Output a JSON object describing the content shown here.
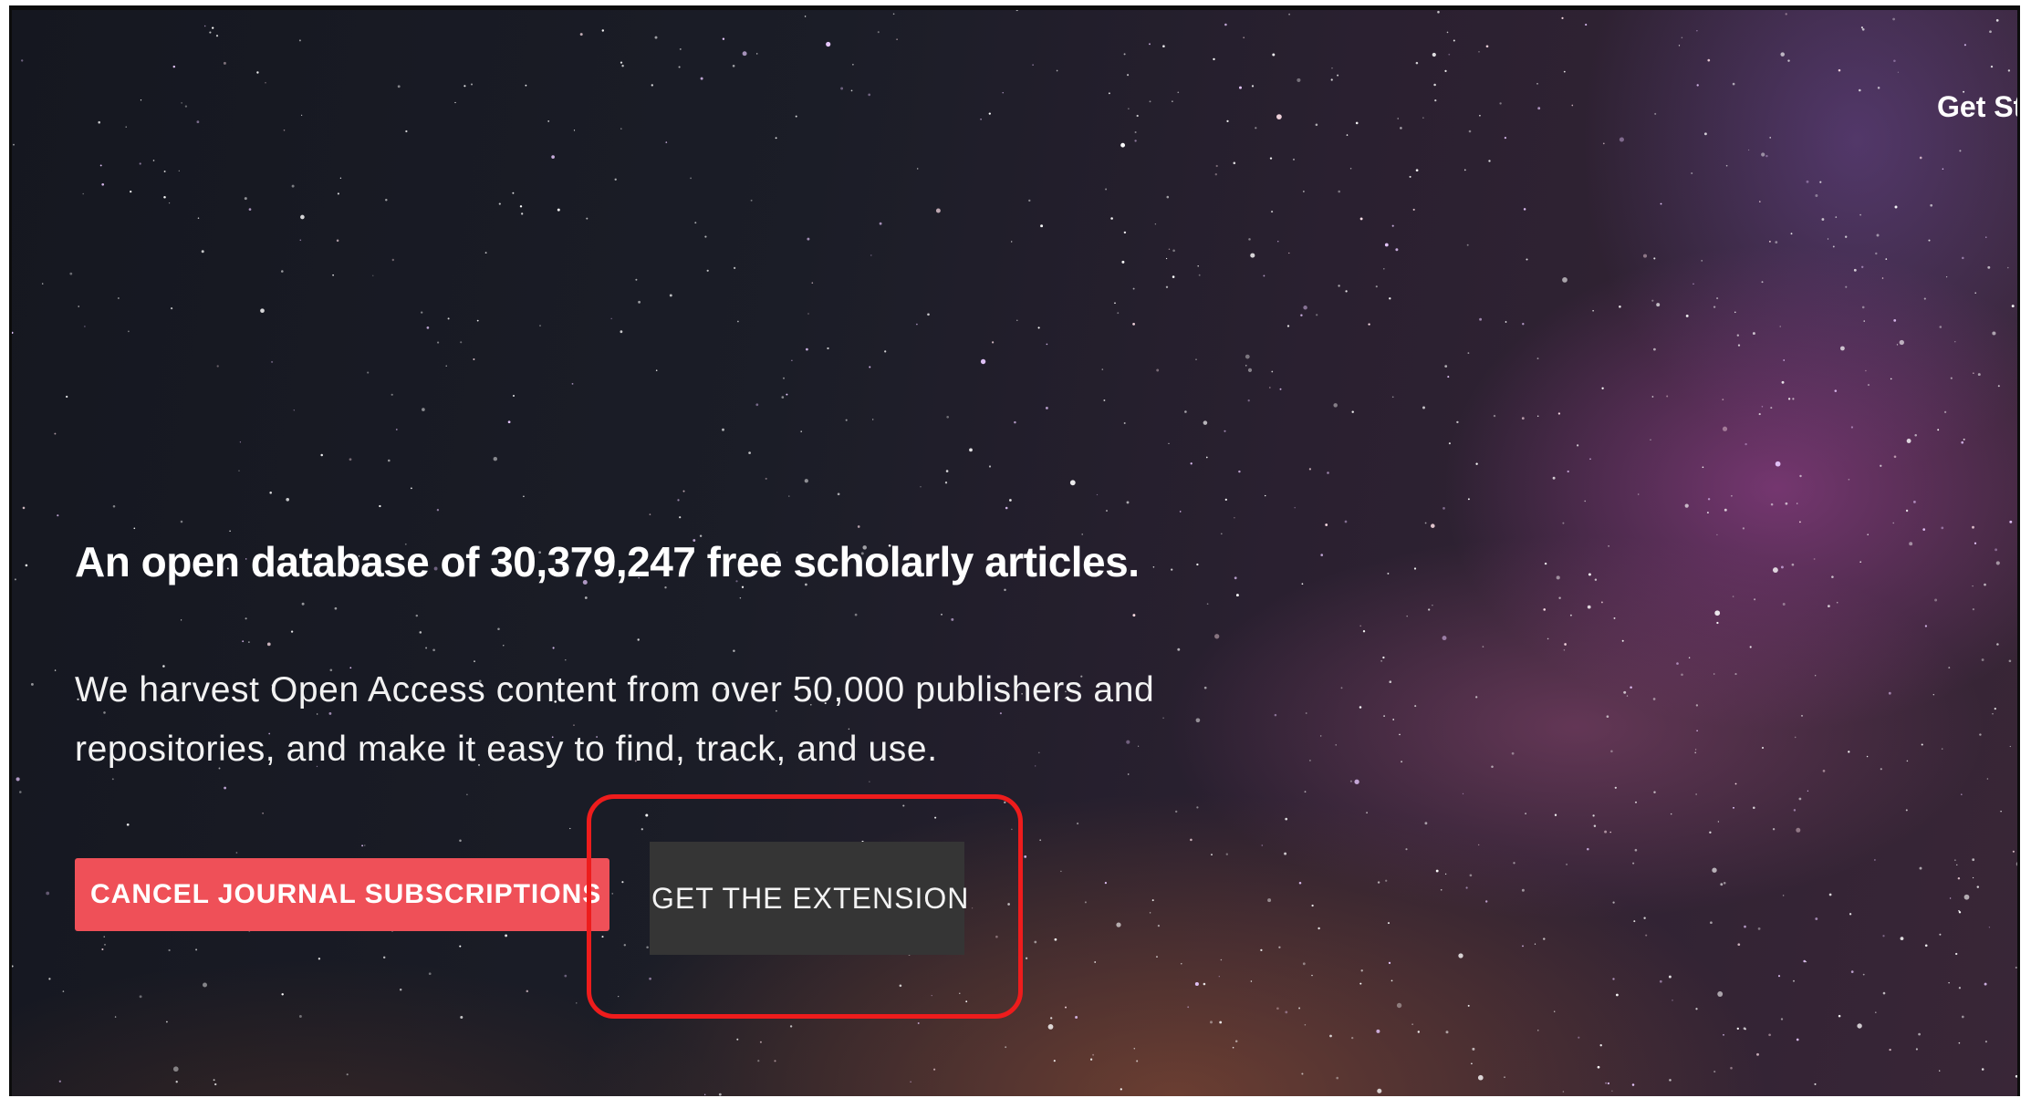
{
  "nav": {
    "get_started_label": "Get Started"
  },
  "hero": {
    "headline": "An open database of 30,379,247 free scholarly articles.",
    "subtext": "We harvest Open Access content from over 50,000 publishers and repositories, and make it easy to find, track, and use."
  },
  "buttons": {
    "cancel_subscriptions_label": "CANCEL JOURNAL SUBSCRIPTIONS",
    "get_extension_label": "GET THE EXTENSION"
  },
  "colors": {
    "cancel_button": "#ef5058",
    "extension_button": "#353535",
    "highlight_annotation": "#ee1c1c"
  }
}
